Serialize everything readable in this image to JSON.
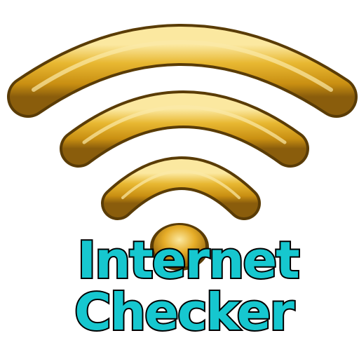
{
  "app": {
    "title_line_1": "Internet",
    "title_line_2": "Checker"
  },
  "icon": {
    "name": "wifi-signal-icon",
    "bar_color": "#e0ae22",
    "bar_highlight": "#f7dd83",
    "bar_shadow": "#8a5d0c",
    "text_color": "#16c7cf",
    "text_outline": "#000000"
  }
}
